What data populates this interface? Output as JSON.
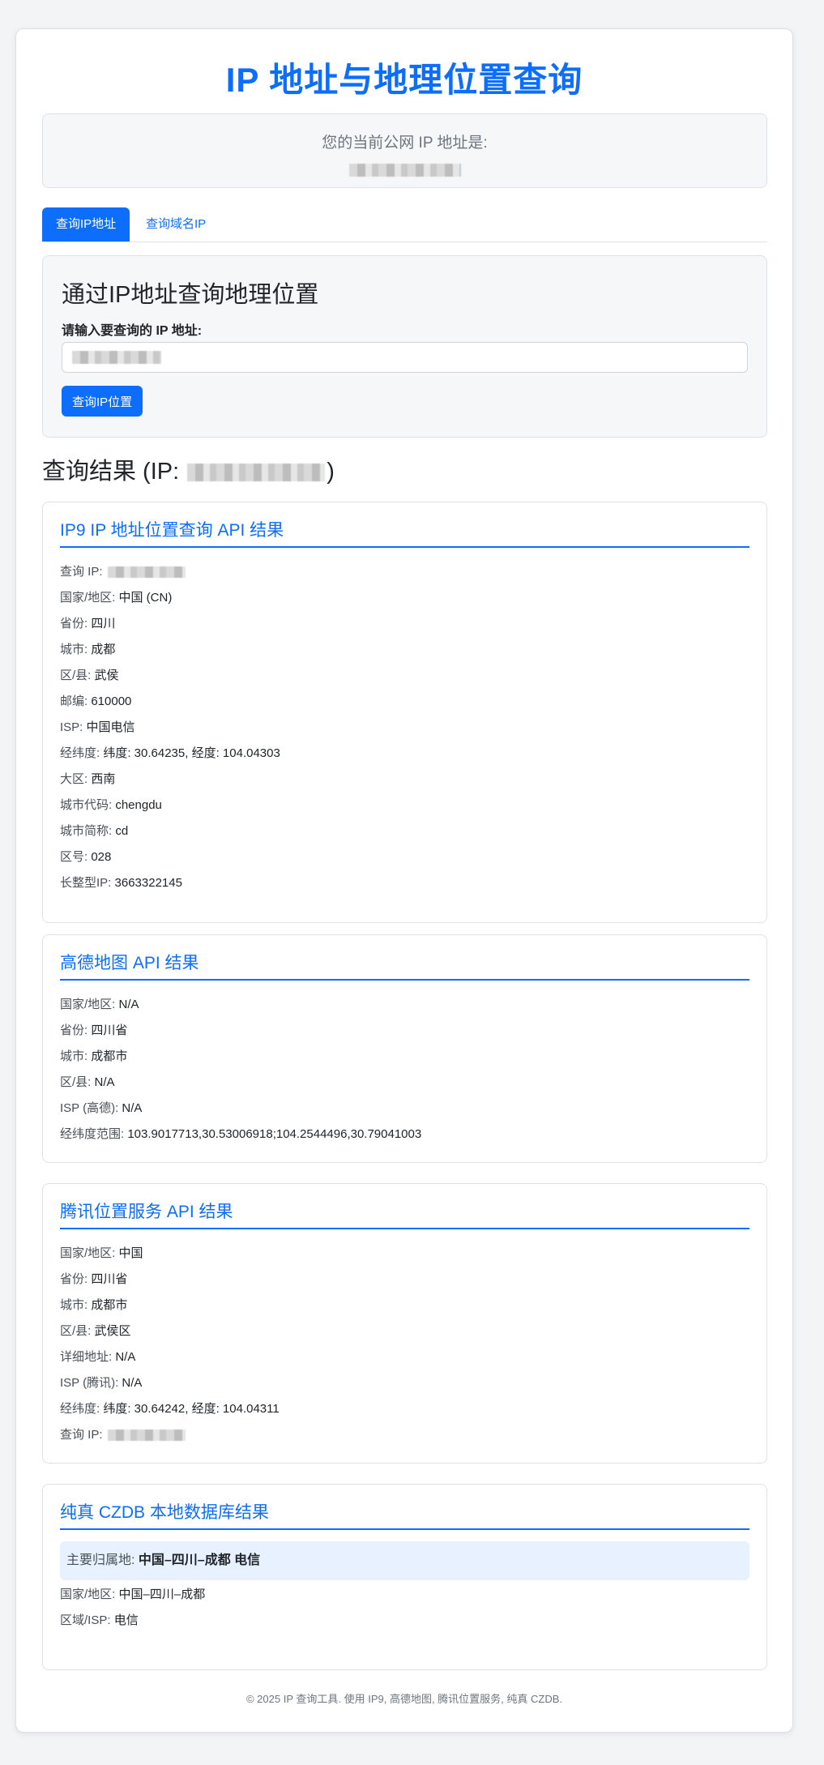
{
  "page": {
    "title": "IP 地址与地理位置查询"
  },
  "current_ip": {
    "label": "您的当前公网 IP 地址是:"
  },
  "tabs": [
    {
      "label": "查询IP地址",
      "active": true
    },
    {
      "label": "查询域名IP",
      "active": false
    }
  ],
  "query": {
    "heading": "通过IP地址查询地理位置",
    "input_label": "请输入要查询的 IP 地址:",
    "button_label": "查询IP位置"
  },
  "result": {
    "heading_prefix": "查询结果 (IP: ",
    "heading_suffix": ")"
  },
  "cards": {
    "ip9": {
      "title": "IP9 IP 地址位置查询 API 结果",
      "rows": [
        {
          "key": "查询 IP: ",
          "value": ""
        },
        {
          "key": "国家/地区: ",
          "value": "中国 (CN)"
        },
        {
          "key": "省份: ",
          "value": "四川"
        },
        {
          "key": "城市: ",
          "value": "成都"
        },
        {
          "key": "区/县: ",
          "value": "武侯"
        },
        {
          "key": "邮编: ",
          "value": "610000"
        },
        {
          "key": "ISP: ",
          "value": "中国电信"
        },
        {
          "key": "经纬度: ",
          "value": "纬度: 30.64235, 经度: 104.04303"
        },
        {
          "key": "大区: ",
          "value": "西南"
        },
        {
          "key": "城市代码: ",
          "value": "chengdu"
        },
        {
          "key": "城市简称: ",
          "value": "cd"
        },
        {
          "key": "区号: ",
          "value": "028"
        },
        {
          "key": "长整型IP: ",
          "value": "3663322145"
        }
      ]
    },
    "amap": {
      "title": "高德地图 API 结果",
      "rows": [
        {
          "key": "国家/地区: ",
          "value": "N/A"
        },
        {
          "key": "省份: ",
          "value": "四川省"
        },
        {
          "key": "城市: ",
          "value": "成都市"
        },
        {
          "key": "区/县: ",
          "value": "N/A"
        },
        {
          "key": "ISP (高德): ",
          "value": "N/A"
        },
        {
          "key": "经纬度范围: ",
          "value": "103.9017713,30.53006918;104.2544496,30.79041003"
        }
      ]
    },
    "tencent": {
      "title": "腾讯位置服务 API 结果",
      "rows": [
        {
          "key": "国家/地区: ",
          "value": "中国"
        },
        {
          "key": "省份: ",
          "value": "四川省"
        },
        {
          "key": "城市: ",
          "value": "成都市"
        },
        {
          "key": "区/县: ",
          "value": "武侯区"
        },
        {
          "key": "详细地址: ",
          "value": "N/A"
        },
        {
          "key": "ISP (腾讯): ",
          "value": "N/A"
        },
        {
          "key": "经纬度: ",
          "value": "纬度: 30.64242, 经度: 104.04311"
        },
        {
          "key": "查询 IP: ",
          "value": ""
        }
      ]
    },
    "czdb": {
      "title": "纯真 CZDB 本地数据库结果",
      "highlight_key": "主要归属地: ",
      "highlight_value": "中国–四川–成都 电信",
      "rows": [
        {
          "key": "国家/地区: ",
          "value": "中国–四川–成都"
        },
        {
          "key": "区域/ISP: ",
          "value": "电信"
        }
      ]
    }
  },
  "footer": {
    "text": "© 2025 IP 查询工具. 使用 IP9, 高德地图, 腾讯位置服务, 纯真 CZDB."
  },
  "colors": {
    "accent": "#0d6efd",
    "panel_bg": "#f6f7f9",
    "highlight_bg": "#e7f1ff"
  }
}
